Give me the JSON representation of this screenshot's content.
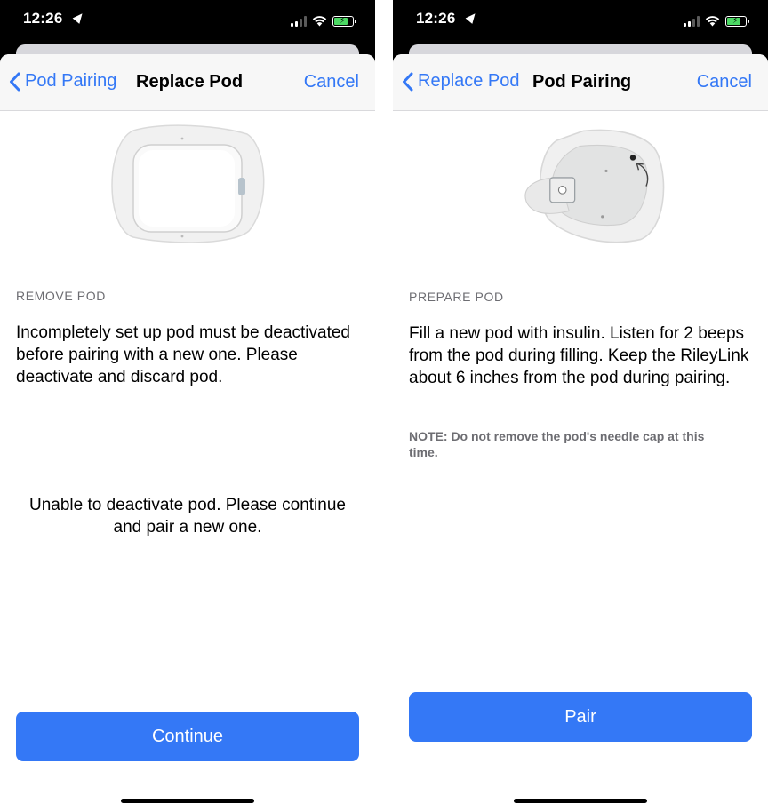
{
  "status_bar": {
    "time": "12:26"
  },
  "left_screen": {
    "nav": {
      "back_label": "Pod Pairing",
      "title": "Replace Pod",
      "cancel_label": "Cancel"
    },
    "section_label": "REMOVE POD",
    "instruction": "Incompletely set up pod must be deactivated before pairing with a new one. Please deactivate and discard pod.",
    "status_message": "Unable to deactivate pod. Please continue and pair a new one.",
    "button_label": "Continue"
  },
  "right_screen": {
    "nav": {
      "back_label": "Replace Pod",
      "title": "Pod Pairing",
      "cancel_label": "Cancel"
    },
    "section_label": "PREPARE POD",
    "instruction": "Fill a new pod with insulin. Listen for 2 beeps from the pod during filling. Keep the RileyLink about 6 inches from the pod during pairing.",
    "note": "NOTE: Do not remove the pod's needle cap at this time.",
    "button_label": "Pair"
  },
  "colors": {
    "accent": "#3478f6",
    "battery": "#4cd964"
  }
}
